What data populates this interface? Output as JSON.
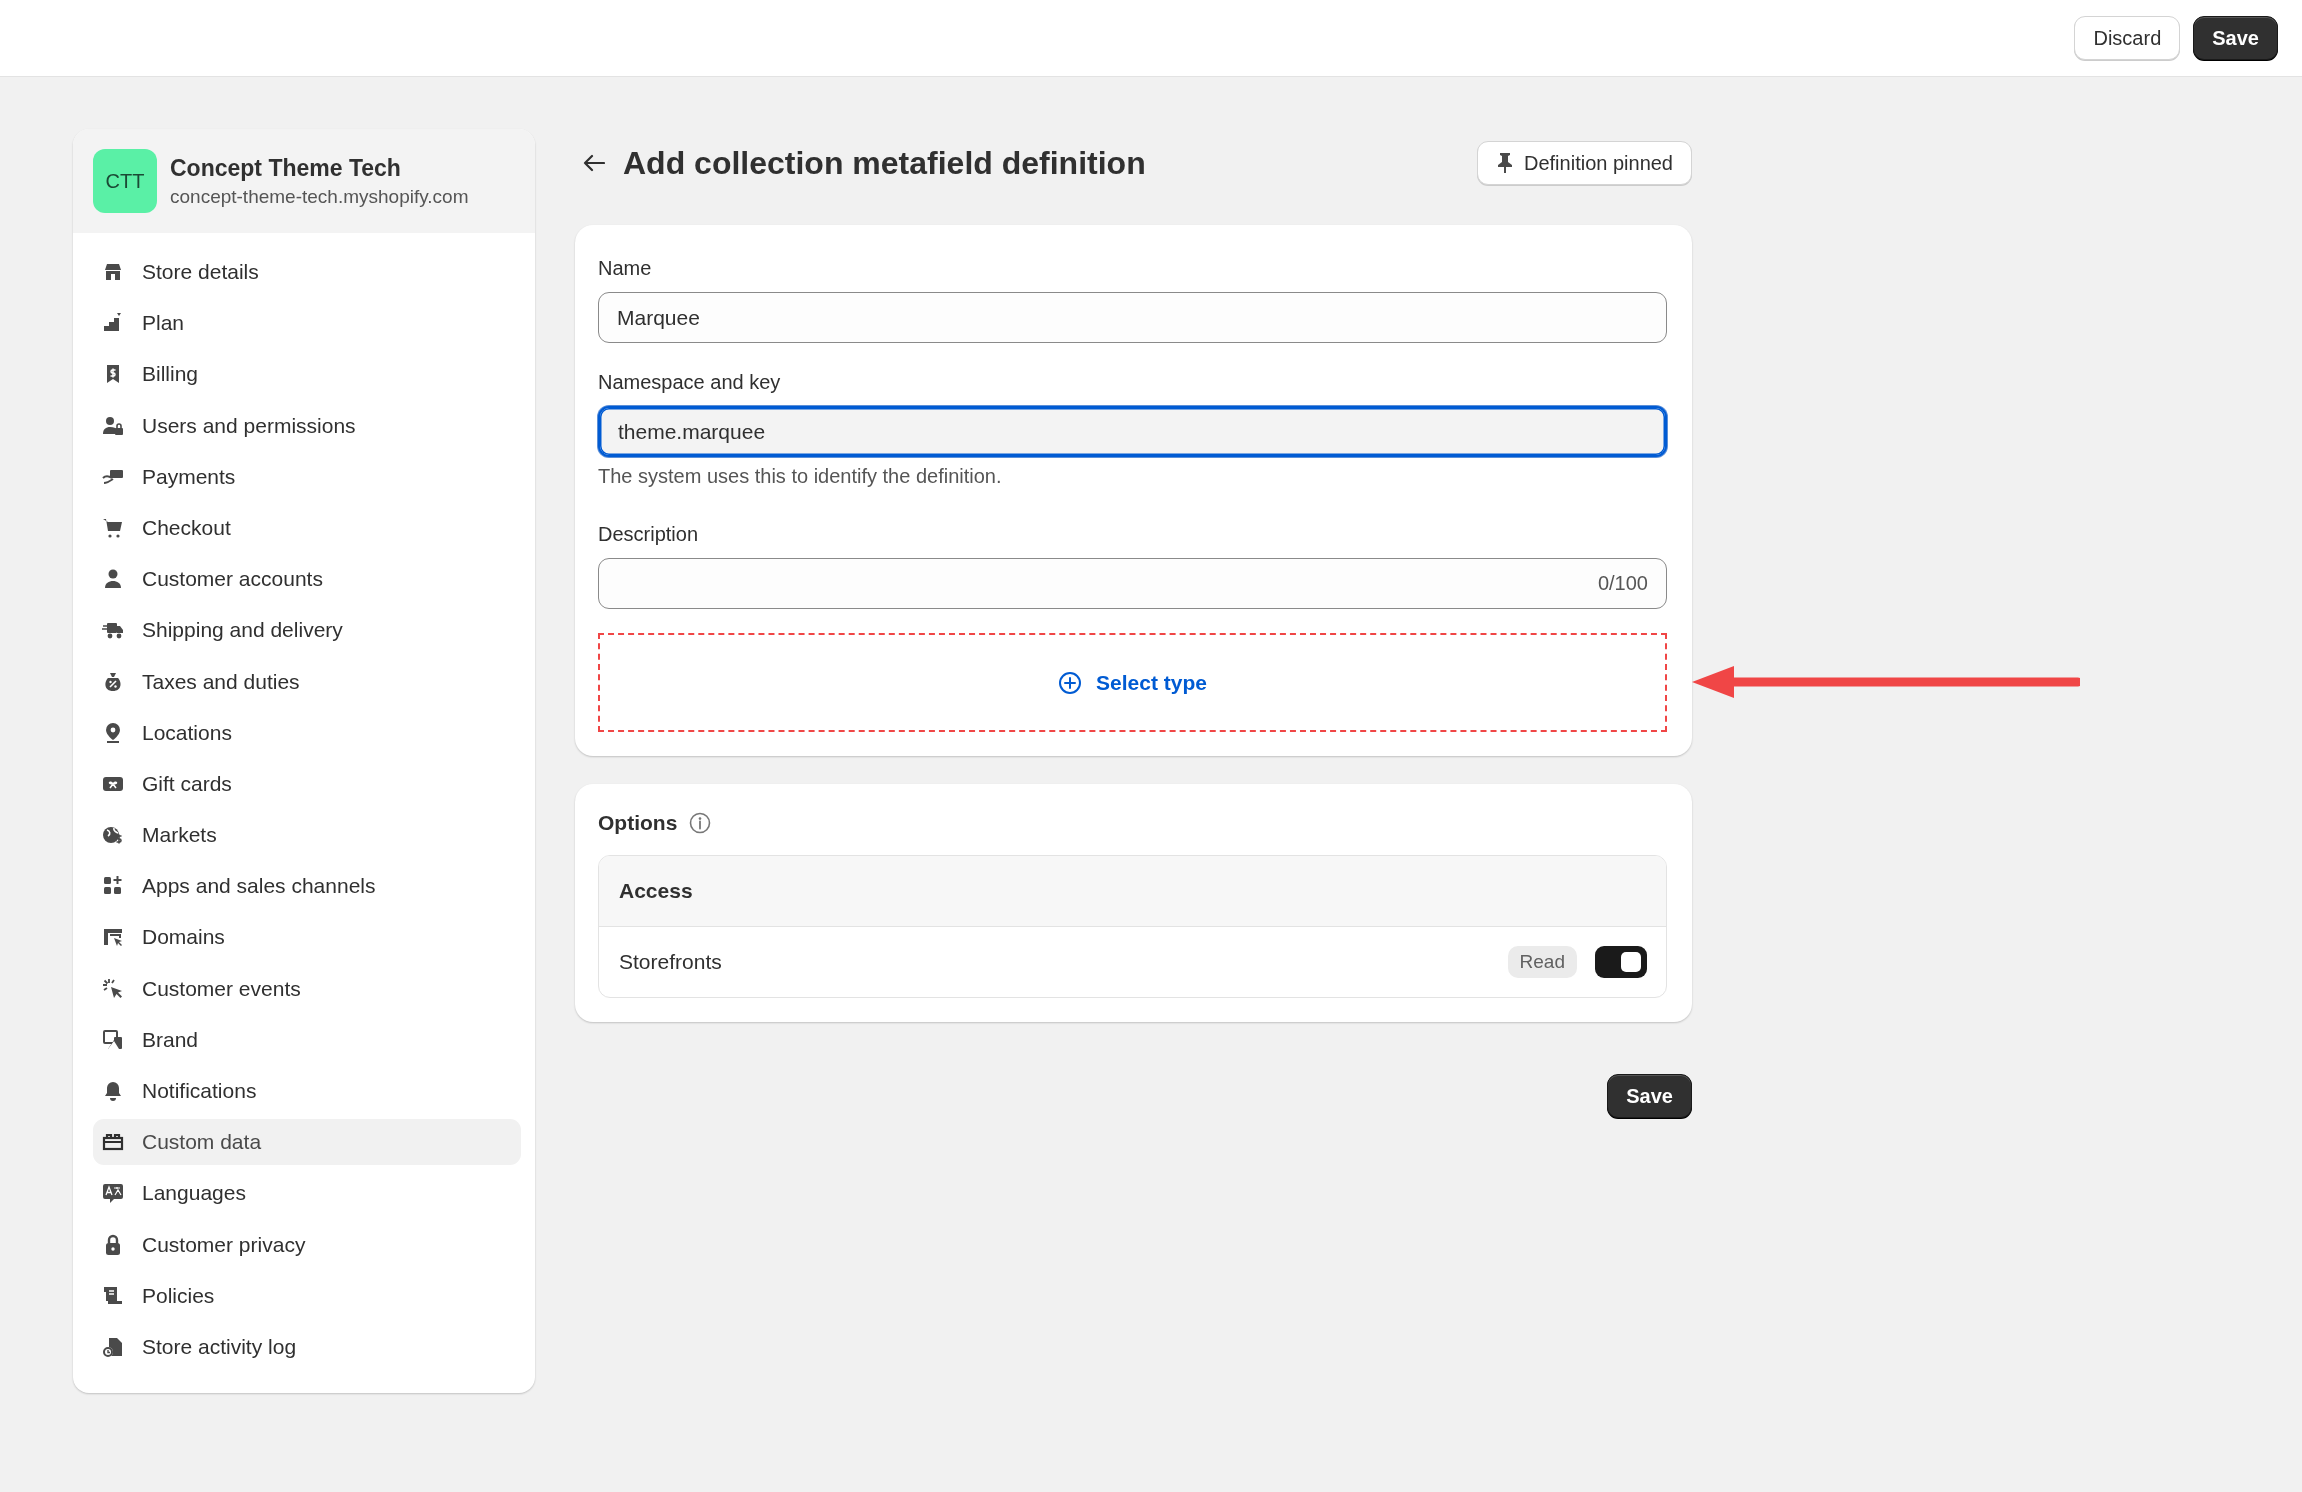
{
  "top_bar": {
    "buttons": [
      {
        "label": "Discard",
        "kind": "secondary"
      },
      {
        "label": "Save",
        "kind": "primary"
      }
    ]
  },
  "sidebar": {
    "store": {
      "initials": "CTT",
      "name": "Concept Theme Tech",
      "domain": "concept-theme-tech.myshopify.com"
    },
    "items": [
      {
        "label": "Store details",
        "selected": false
      },
      {
        "label": "Plan",
        "selected": false
      },
      {
        "label": "Billing",
        "selected": false
      },
      {
        "label": "Users and permissions",
        "selected": false
      },
      {
        "label": "Payments",
        "selected": false
      },
      {
        "label": "Checkout",
        "selected": false
      },
      {
        "label": "Customer accounts",
        "selected": false
      },
      {
        "label": "Shipping and delivery",
        "selected": false
      },
      {
        "label": "Taxes and duties",
        "selected": false
      },
      {
        "label": "Locations",
        "selected": false
      },
      {
        "label": "Gift cards",
        "selected": false
      },
      {
        "label": "Markets",
        "selected": false
      },
      {
        "label": "Apps and sales channels",
        "selected": false
      },
      {
        "label": "Domains",
        "selected": false
      },
      {
        "label": "Customer events",
        "selected": false
      },
      {
        "label": "Brand",
        "selected": false
      },
      {
        "label": "Notifications",
        "selected": false
      },
      {
        "label": "Custom data",
        "selected": true
      },
      {
        "label": "Languages",
        "selected": false
      },
      {
        "label": "Customer privacy",
        "selected": false
      },
      {
        "label": "Policies",
        "selected": false
      },
      {
        "label": "Store activity log",
        "selected": false
      }
    ]
  },
  "page": {
    "title": "Add collection metafield definition",
    "pin_button": "Definition pinned"
  },
  "form": {
    "fields": [
      {
        "label": "Name",
        "value": "Marquee",
        "focused": false
      },
      {
        "label": "Namespace and key",
        "value": "theme.marquee",
        "focused": true,
        "help": "The system uses this to identify the definition."
      },
      {
        "label": "Description",
        "counter": "0/100",
        "focused": false
      }
    ],
    "select_type": "Select type"
  },
  "options": {
    "title": "Options",
    "section": "Access",
    "rows": [
      {
        "label": "Storefronts",
        "badge": "Read",
        "on": true
      }
    ]
  },
  "footer": {
    "save": "Save"
  }
}
